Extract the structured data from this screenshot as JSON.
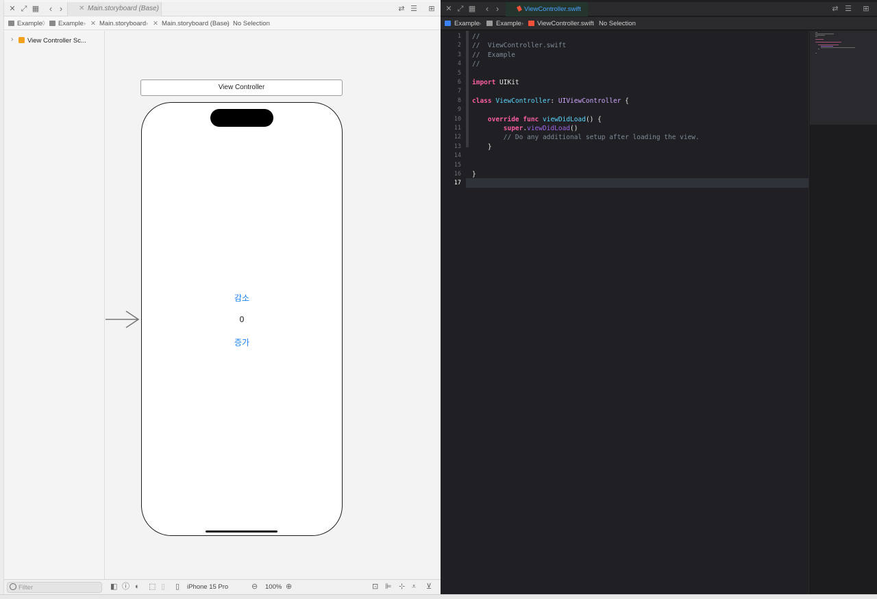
{
  "left_pane": {
    "tab_title": "Main.storyboard (Base)",
    "breadcrumb": {
      "item1": "Example",
      "item2": "Example",
      "item3": "Main.storyboard",
      "item4": "Main.storyboard (Base)",
      "item5": "No Selection"
    },
    "outline": {
      "item": "View Controller Sc..."
    },
    "scene": {
      "title": "View Controller",
      "decrease_label": "감소",
      "count_value": "0",
      "increase_label": "증가"
    },
    "footer": {
      "filter_placeholder": "Filter",
      "device": "iPhone 15 Pro",
      "zoom": "100%"
    }
  },
  "right_pane": {
    "tab_title": "ViewController.swift",
    "breadcrumb": {
      "item1": "Example",
      "item2": "Example",
      "item3": "ViewController.swift",
      "item4": "No Selection"
    },
    "line_numbers": [
      "1",
      "2",
      "3",
      "4",
      "5",
      "6",
      "7",
      "8",
      "9",
      "10",
      "11",
      "12",
      "13",
      "14",
      "15",
      "16",
      "17"
    ],
    "current_line": "17"
  },
  "colors": {
    "accent_blue": "#1a82f5",
    "keyword": "#fc5fa3",
    "comment": "#7f8c98",
    "type": "#5dd8ff",
    "swift_orange": "#f05138"
  }
}
